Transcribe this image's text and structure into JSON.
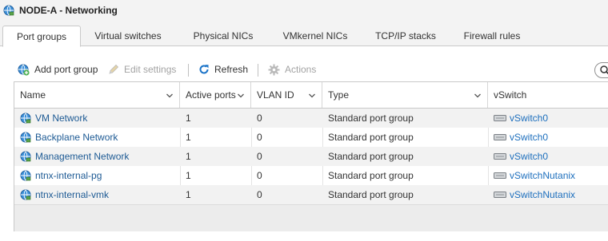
{
  "window": {
    "title": "NODE-A - Networking"
  },
  "tabs": [
    {
      "label": "Port groups",
      "active": true
    },
    {
      "label": "Virtual switches",
      "active": false
    },
    {
      "label": "Physical NICs",
      "active": false
    },
    {
      "label": "VMkernel NICs",
      "active": false
    },
    {
      "label": "TCP/IP stacks",
      "active": false
    },
    {
      "label": "Firewall rules",
      "active": false
    }
  ],
  "toolbar": {
    "add_label": "Add port group",
    "edit_label": "Edit settings",
    "refresh_label": "Refresh",
    "actions_label": "Actions"
  },
  "table": {
    "columns": [
      "Name",
      "Active ports",
      "VLAN ID",
      "Type",
      "vSwitch"
    ],
    "rows": [
      {
        "name": "VM Network",
        "active_ports": "1",
        "vlan_id": "0",
        "type": "Standard port group",
        "vswitch": "vSwitch0"
      },
      {
        "name": "Backplane Network",
        "active_ports": "1",
        "vlan_id": "0",
        "type": "Standard port group",
        "vswitch": "vSwitch0"
      },
      {
        "name": "Management Network",
        "active_ports": "1",
        "vlan_id": "0",
        "type": "Standard port group",
        "vswitch": "vSwitch0"
      },
      {
        "name": "ntnx-internal-pg",
        "active_ports": "1",
        "vlan_id": "0",
        "type": "Standard port group",
        "vswitch": "vSwitchNutanix"
      },
      {
        "name": "ntnx-internal-vmk",
        "active_ports": "1",
        "vlan_id": "0",
        "type": "Standard port group",
        "vswitch": "vSwitchNutanix"
      }
    ]
  },
  "colors": {
    "link": "#1d5a94",
    "vswitch_link": "#1d6fbd",
    "refresh_icon": "#1a73c8",
    "globe_icon": "#2a7fd0",
    "plus_icon": "#4caf50"
  }
}
